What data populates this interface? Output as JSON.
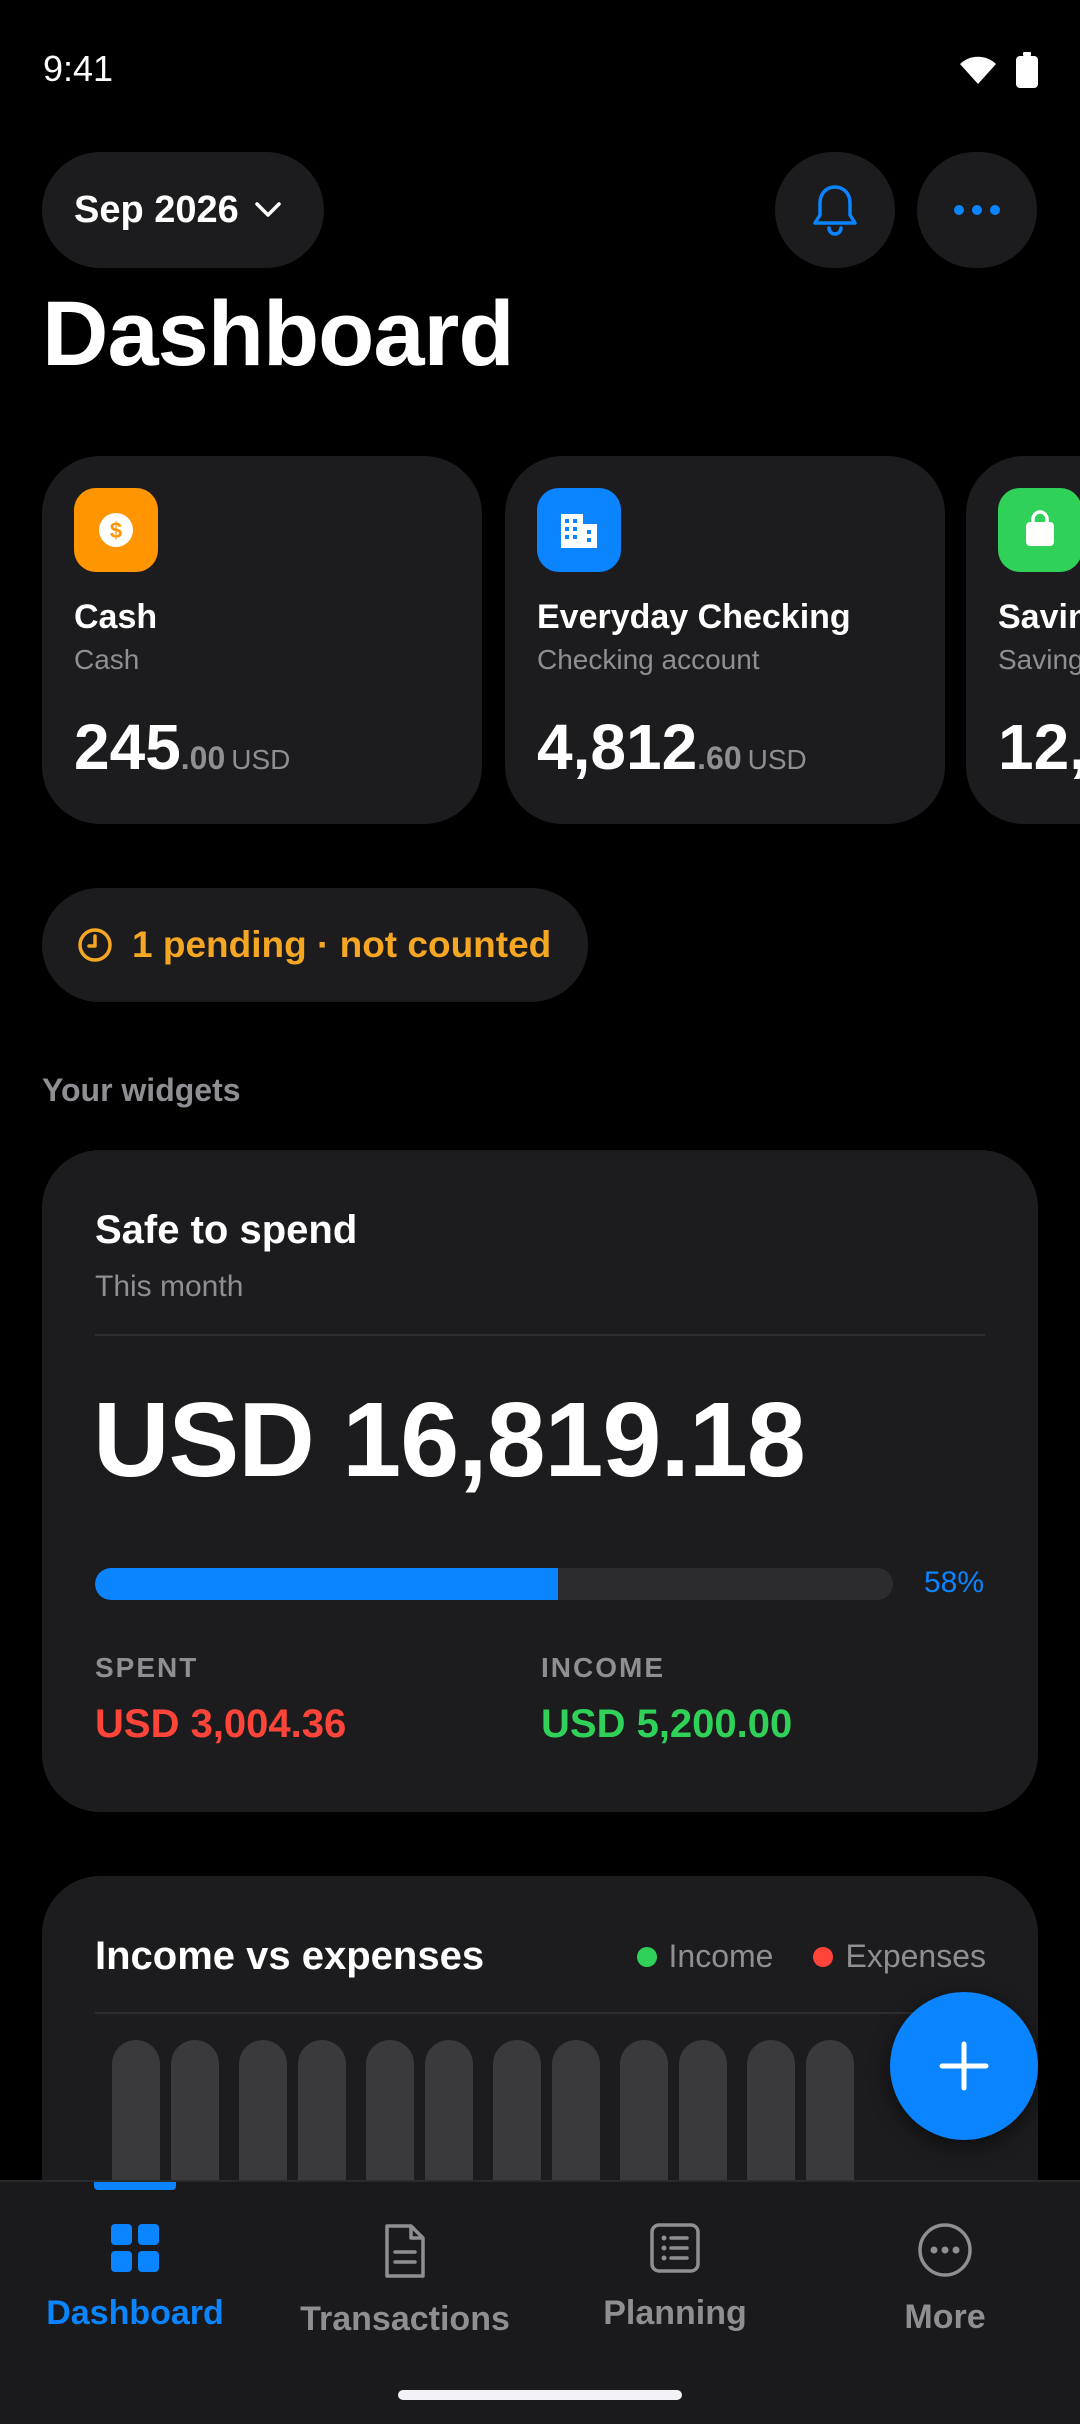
{
  "status_bar": {
    "time": "9:41"
  },
  "header": {
    "month": "Sep 2026",
    "title": "Dashboard"
  },
  "accounts": [
    {
      "name": "Cash",
      "type": "Cash",
      "balance_int": "245",
      "balance_dec": ".00",
      "currency": "USD",
      "color": "#ff9500",
      "icon": "dollar-icon"
    },
    {
      "name": "Everyday Checking",
      "type": "Checking account",
      "balance_int": "4,812",
      "balance_dec": ".60",
      "currency": "USD",
      "color": "#0a84ff",
      "icon": "building-icon"
    },
    {
      "name": "Savin",
      "type": "Saving",
      "balance_int": "12,",
      "balance_dec": "",
      "currency": "",
      "color": "#30d158",
      "icon": "bag-icon"
    }
  ],
  "pending": {
    "text": "1 pending · not counted",
    "color": "#f5a623"
  },
  "widgets_label": "Your widgets",
  "safe_to_spend": {
    "title": "Safe to spend",
    "subtitle": "This month",
    "amount": "USD 16,819.18",
    "progress": 0.58,
    "progress_label": "58%",
    "spent_label": "SPENT",
    "spent_value": "USD 3,004.36",
    "income_label": "INCOME",
    "income_value": "USD 5,200.00"
  },
  "income_vs_expenses": {
    "title": "Income vs expenses",
    "legend": [
      {
        "label": "Income",
        "color": "#30d158"
      },
      {
        "label": "Expenses",
        "color": "#ff453a"
      }
    ],
    "bar_count": 12
  },
  "tabs": [
    {
      "label": "Dashboard",
      "icon": "grid-icon",
      "active": true
    },
    {
      "label": "Transactions",
      "icon": "document-icon",
      "active": false
    },
    {
      "label": "Planning",
      "icon": "list-icon",
      "active": false
    },
    {
      "label": "More",
      "icon": "more-circle-icon",
      "active": false
    }
  ],
  "colors": {
    "accent": "#0a84ff",
    "card": "#1c1c1e",
    "spent": "#ff453a",
    "income": "#30d158"
  }
}
